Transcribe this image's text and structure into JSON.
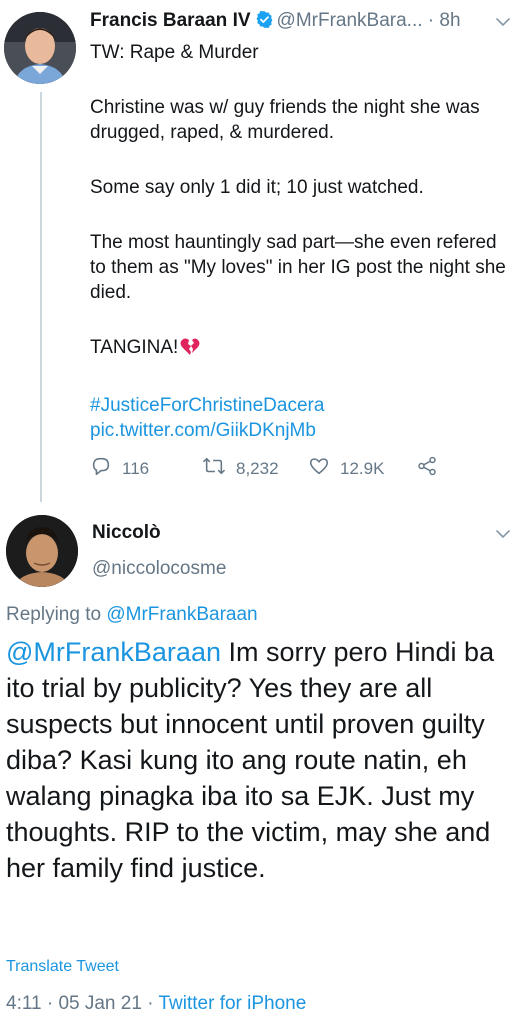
{
  "tweet": {
    "author_name": "Francis Baraan IV",
    "handle": "@MrFrankBara...",
    "separator": "·",
    "time": "8h",
    "content_warning": "TW: Rape & Murder",
    "paragraph1": "Christine was w/ guy friends the night she was drugged, raped, & murdered.",
    "paragraph2": "Some say only 1 did it; 10 just watched.",
    "paragraph3": "The most hauntingly sad part—she even refered to them as \"My loves\" in her IG post the night she died.",
    "paragraph4": "TANGINA!",
    "hashtag": "#JusticeForChristineDacera",
    "pic_link": "pic.twitter.com/GiikDKnjMb",
    "replies": "116",
    "retweets": "8,232",
    "likes": "12.9K"
  },
  "reply": {
    "author_name": "Niccolò",
    "handle": "@niccolocosme",
    "replying_label": "Replying to",
    "replying_handle": "@MrFrankBaraan",
    "mention": "@MrFrankBaraan",
    "text": " Im sorry pero Hindi ba ito trial by publicity? Yes they are all suspects but innocent until proven guilty diba? Kasi kung ito ang route natin, eh walang pinagka iba ito sa EJK. Just my thoughts. RIP to the victim, may she and her family find justice.",
    "translate_label": "Translate Tweet",
    "timestamp": "4:11 · 05 Jan 21 · ",
    "source": "Twitter for iPhone"
  },
  "colors": {
    "link": "#1b95e0",
    "secondary_text": "#657786",
    "verified_badge": "#1da1f2",
    "heart_emoji": "#e0245e"
  },
  "icons": [
    "verified-badge-icon",
    "chevron-down-icon",
    "reply-icon",
    "retweet-icon",
    "like-icon",
    "share-icon",
    "broken-heart-icon"
  ]
}
